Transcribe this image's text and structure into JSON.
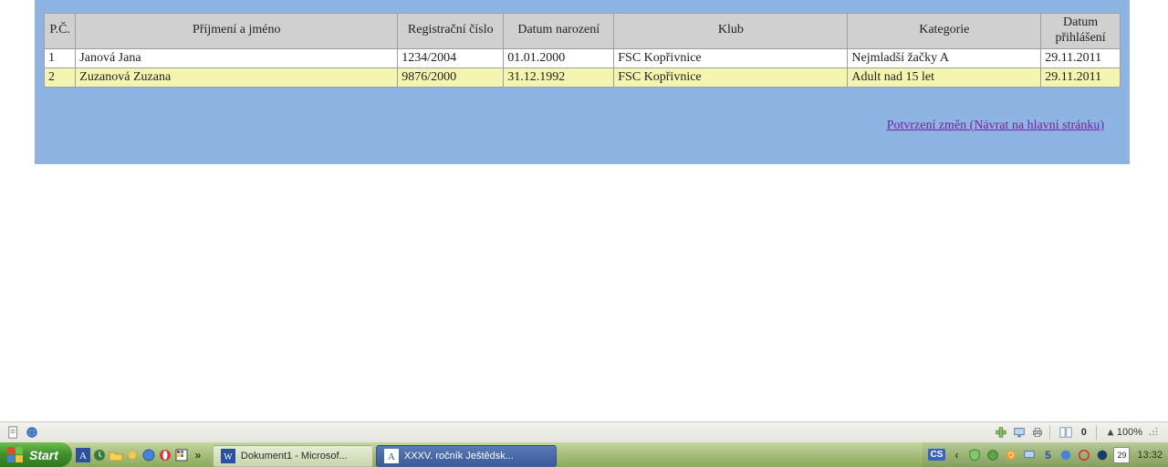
{
  "table": {
    "headers": {
      "pc": "P.Č.",
      "name": "Příjmení a jméno",
      "reg": "Registrační číslo",
      "birth": "Datum narození",
      "club": "Klub",
      "category": "Kategorie",
      "signup": "Datum přihlášení"
    },
    "rows": [
      {
        "pc": "1",
        "name": "Janová Jana",
        "reg": "1234/2004",
        "birth": "01.01.2000",
        "club": "FSC Kopřivnice",
        "category": "Nejmladší žačky A",
        "signup": "29.11.2011"
      },
      {
        "pc": "2",
        "name": "Zuzanová Zuzana",
        "reg": "9876/2000",
        "birth": "31.12.1992",
        "club": "FSC Kopřivnice",
        "category": "Adult nad 15 let",
        "signup": "29.11.2011"
      }
    ]
  },
  "link": {
    "label": "Potvrzení změn (Návrat na hlavní stránku)"
  },
  "statusbar": {
    "page_count": "0",
    "zoom": "100%"
  },
  "taskbar": {
    "start": "Start",
    "items": [
      {
        "icon": "word-icon",
        "label": "Dokument1 - Microsof..."
      },
      {
        "icon": "app-a-icon",
        "label": "XXXV. ročník Ještědsk..."
      }
    ],
    "lang": "CS",
    "tray_numbers": {
      "five": "5",
      "date": "29"
    },
    "clock": "13:32"
  }
}
